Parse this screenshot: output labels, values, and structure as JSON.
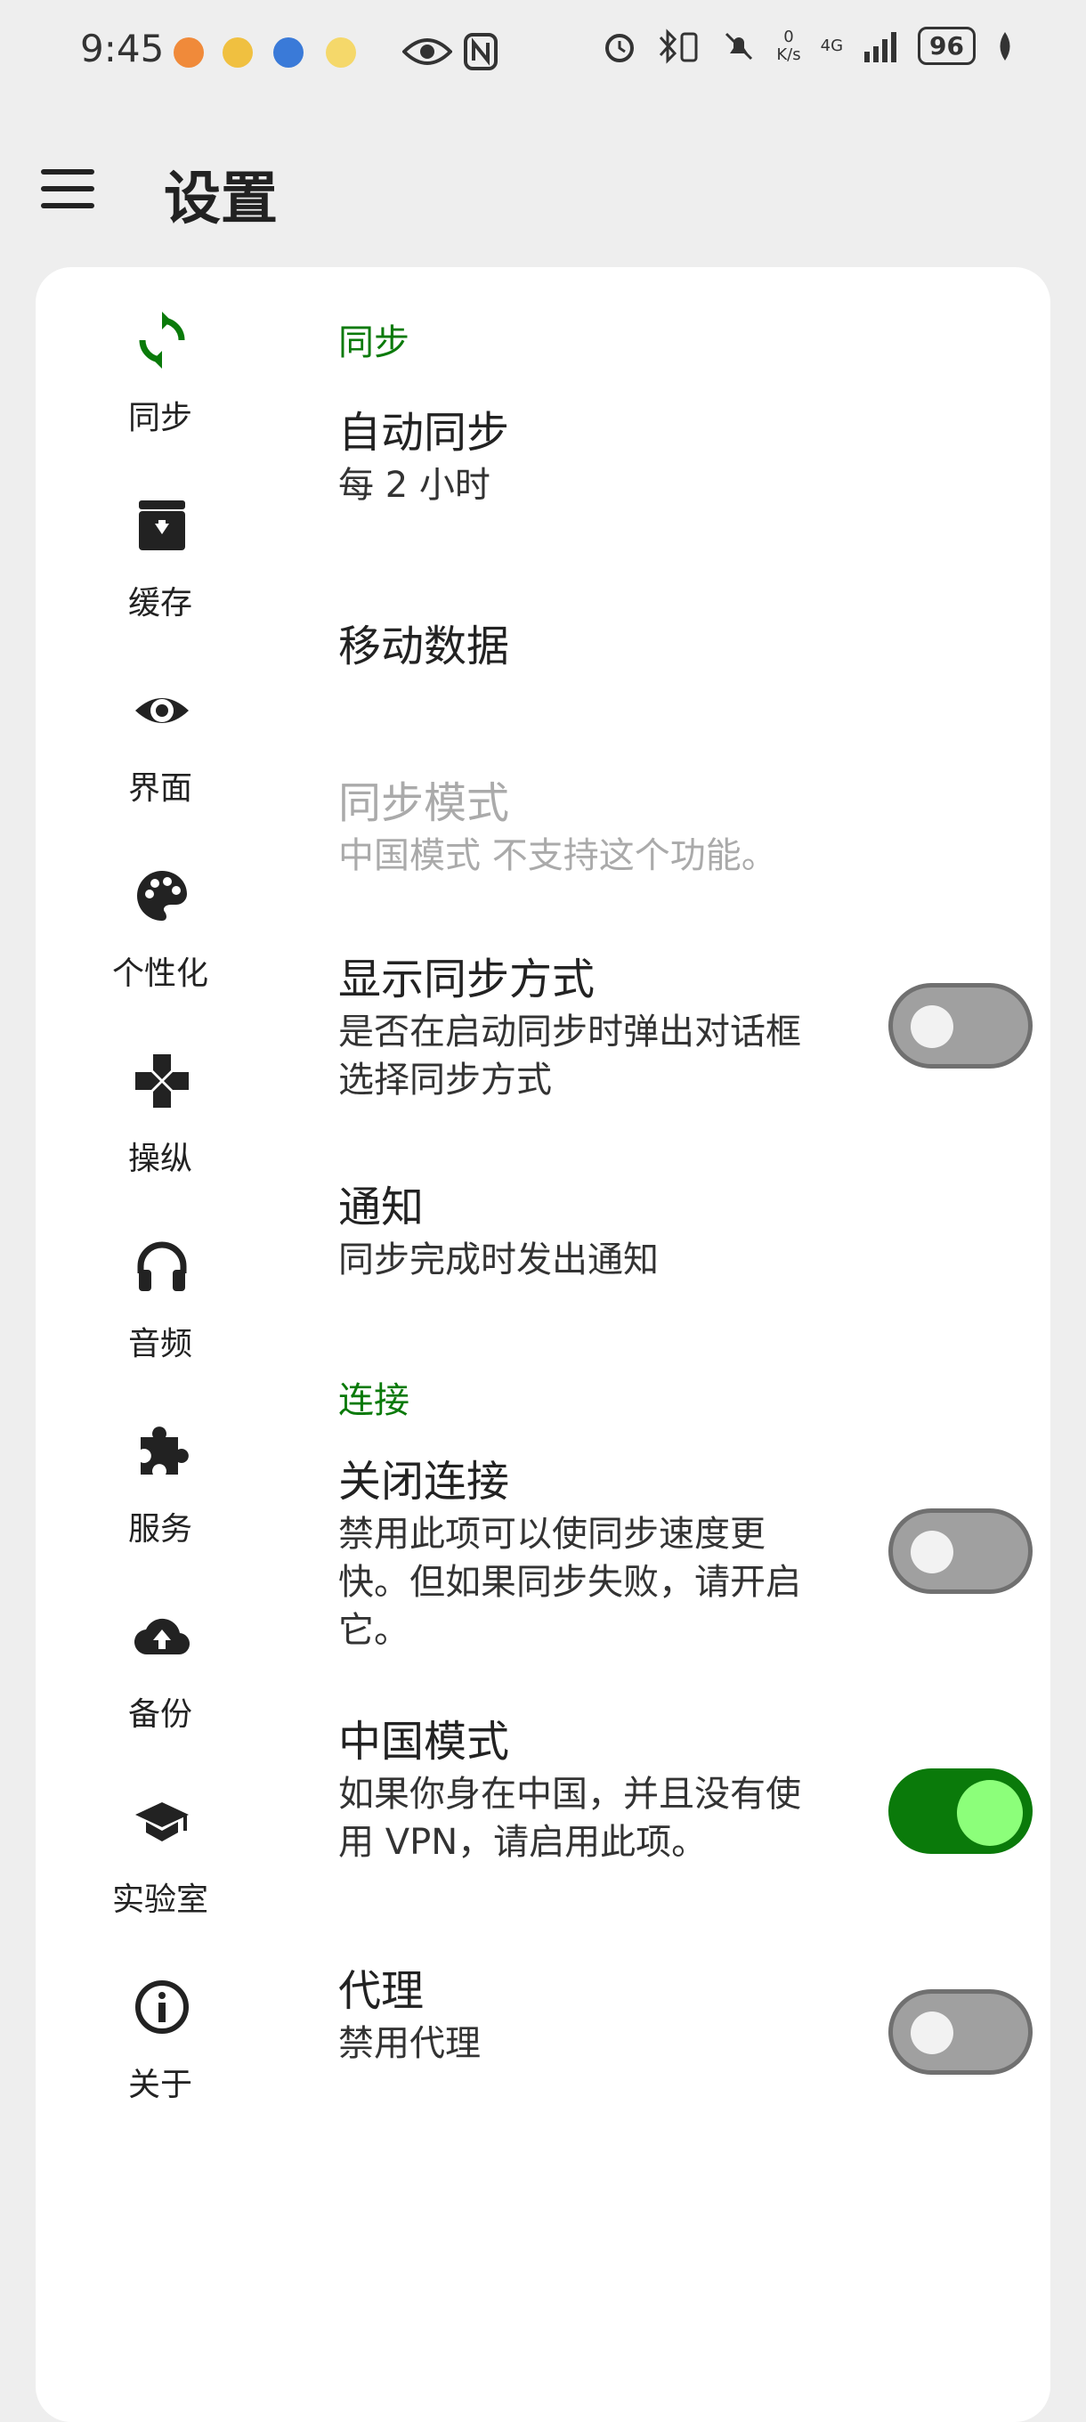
{
  "status_bar": {
    "time": "9:45",
    "speed_top": "0",
    "speed_unit": "K/s",
    "network": "4G",
    "battery": "96"
  },
  "app_bar": {
    "title": "设置"
  },
  "nav": [
    {
      "label": "同步",
      "icon": "sync-icon"
    },
    {
      "label": "缓存",
      "icon": "archive-icon"
    },
    {
      "label": "界面",
      "icon": "eye-icon"
    },
    {
      "label": "个性化",
      "icon": "palette-icon"
    },
    {
      "label": "操纵",
      "icon": "gamepad-icon"
    },
    {
      "label": "音频",
      "icon": "headphones-icon"
    },
    {
      "label": "服务",
      "icon": "puzzle-icon"
    },
    {
      "label": "备份",
      "icon": "cloud-upload-icon"
    },
    {
      "label": "实验室",
      "icon": "school-icon"
    },
    {
      "label": "关于",
      "icon": "info-icon"
    }
  ],
  "sections": {
    "sync_header": "同步",
    "connection_header": "连接"
  },
  "prefs": {
    "auto_sync": {
      "title": "自动同步",
      "summary": "每 2 小时"
    },
    "mobile_data": {
      "title": "移动数据"
    },
    "sync_mode": {
      "title": "同步模式",
      "summary": "中国模式 不支持这个功能。"
    },
    "show_sync_method": {
      "title": "显示同步方式",
      "summary": "是否在启动同步时弹出对话框选择同步方式",
      "enabled": false
    },
    "notification": {
      "title": "通知",
      "summary": "同步完成时发出通知"
    },
    "close_connection": {
      "title": "关闭连接",
      "summary": "禁用此项可以使同步速度更快。但如果同步失败，请开启它。",
      "enabled": false
    },
    "china_mode": {
      "title": "中国模式",
      "summary": "如果你身在中国，并且没有使用 VPN，请启用此项。",
      "enabled": true
    },
    "proxy": {
      "title": "代理",
      "summary": "禁用代理",
      "enabled": false
    }
  },
  "colors": {
    "accent": "#0a7a0a",
    "switch_on_knob": "#8cff7a",
    "background": "#eeeeee"
  }
}
